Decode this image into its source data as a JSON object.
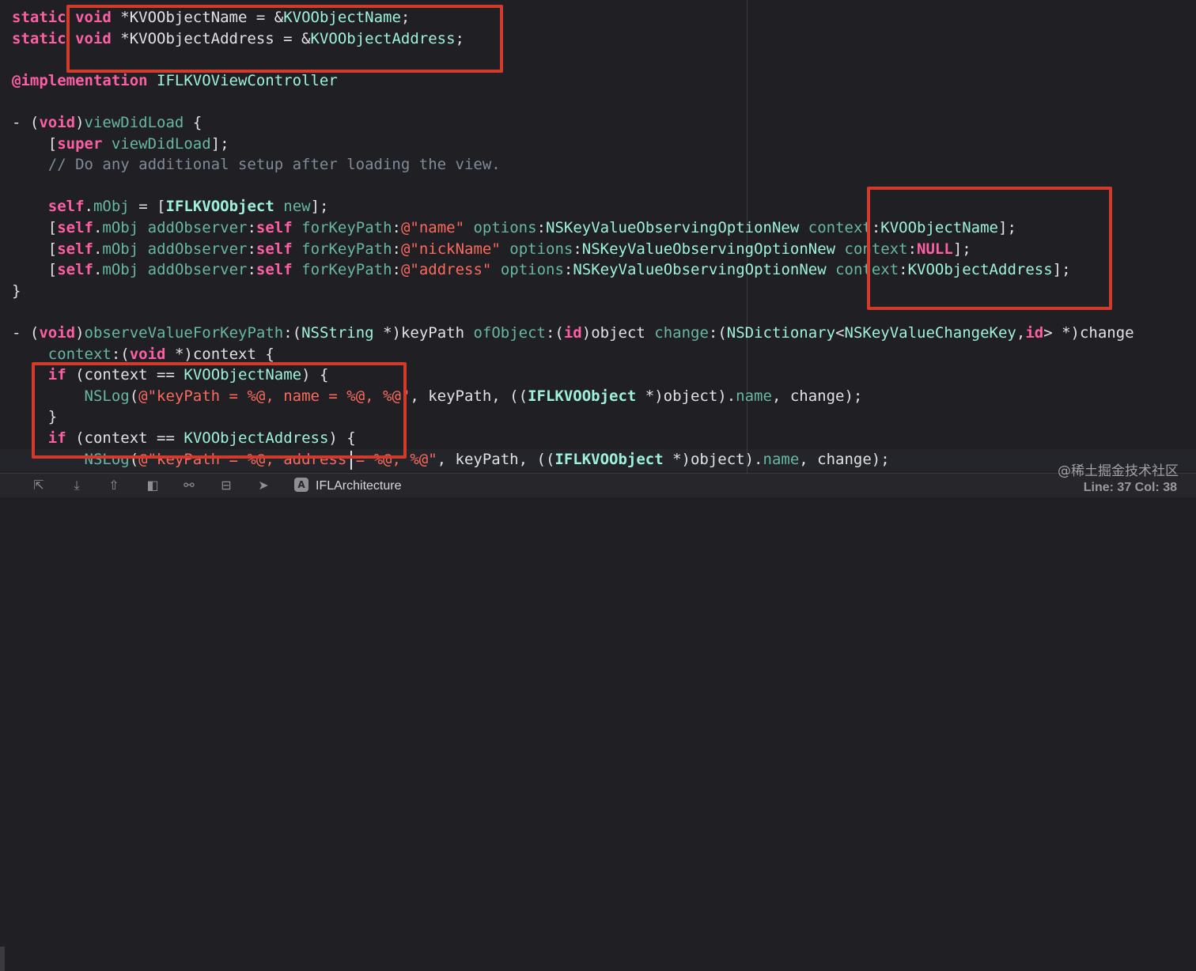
{
  "editor": {
    "lines": [
      [
        {
          "t": "static ",
          "c": "kw"
        },
        {
          "t": "void ",
          "c": "kw"
        },
        {
          "t": "*KVOObjectName = &",
          "c": "pl"
        },
        {
          "t": "KVOObjectName",
          "c": "ty"
        },
        {
          "t": ";",
          "c": "pl"
        }
      ],
      [
        {
          "t": "static ",
          "c": "kw"
        },
        {
          "t": "void ",
          "c": "kw"
        },
        {
          "t": "*KVOObjectAddress = &",
          "c": "pl"
        },
        {
          "t": "KVOObjectAddress",
          "c": "ty"
        },
        {
          "t": ";",
          "c": "pl"
        }
      ],
      [],
      [
        {
          "t": "@implementation ",
          "c": "kw"
        },
        {
          "t": "IFLKVOViewController",
          "c": "ty"
        }
      ],
      [],
      [
        {
          "t": "- (",
          "c": "pl"
        },
        {
          "t": "void",
          "c": "kw"
        },
        {
          "t": ")",
          "c": "pl"
        },
        {
          "t": "viewDidLoad",
          "c": "fn"
        },
        {
          "t": " {",
          "c": "pl"
        }
      ],
      [
        {
          "t": "    [",
          "c": "pl"
        },
        {
          "t": "super ",
          "c": "kw"
        },
        {
          "t": "viewDidLoad",
          "c": "fn"
        },
        {
          "t": "];",
          "c": "pl"
        }
      ],
      [
        {
          "t": "    // Do any additional setup after loading the view.",
          "c": "cm"
        }
      ],
      [],
      [
        {
          "t": "    ",
          "c": "pl"
        },
        {
          "t": "self",
          "c": "kw"
        },
        {
          "t": ".",
          "c": "pl"
        },
        {
          "t": "mObj",
          "c": "fn"
        },
        {
          "t": " = [",
          "c": "pl"
        },
        {
          "t": "IFLKVOObject",
          "c": "cls sel"
        },
        {
          "t": " ",
          "c": "pl"
        },
        {
          "t": "new",
          "c": "fn"
        },
        {
          "t": "];",
          "c": "pl"
        }
      ],
      [
        {
          "t": "    [",
          "c": "pl"
        },
        {
          "t": "self",
          "c": "kw"
        },
        {
          "t": ".",
          "c": "pl"
        },
        {
          "t": "mObj ",
          "c": "fn"
        },
        {
          "t": "addObserver",
          "c": "fn"
        },
        {
          "t": ":",
          "c": "pl"
        },
        {
          "t": "self ",
          "c": "kw"
        },
        {
          "t": "forKeyPath",
          "c": "fn"
        },
        {
          "t": ":",
          "c": "pl"
        },
        {
          "t": "@\"name\" ",
          "c": "str"
        },
        {
          "t": "options",
          "c": "fn"
        },
        {
          "t": ":",
          "c": "pl"
        },
        {
          "t": "NSKeyValueObservingOptionNew ",
          "c": "ty"
        },
        {
          "t": "context",
          "c": "fn"
        },
        {
          "t": ":",
          "c": "pl"
        },
        {
          "t": "KVOObjectName",
          "c": "ty"
        },
        {
          "t": "];",
          "c": "pl"
        }
      ],
      [
        {
          "t": "    [",
          "c": "pl"
        },
        {
          "t": "self",
          "c": "kw"
        },
        {
          "t": ".",
          "c": "pl"
        },
        {
          "t": "mObj ",
          "c": "fn"
        },
        {
          "t": "addObserver",
          "c": "fn"
        },
        {
          "t": ":",
          "c": "pl"
        },
        {
          "t": "self ",
          "c": "kw"
        },
        {
          "t": "forKeyPath",
          "c": "fn"
        },
        {
          "t": ":",
          "c": "pl"
        },
        {
          "t": "@\"nickName\" ",
          "c": "str"
        },
        {
          "t": "options",
          "c": "fn"
        },
        {
          "t": ":",
          "c": "pl"
        },
        {
          "t": "NSKeyValueObservingOptionNew ",
          "c": "ty"
        },
        {
          "t": "context",
          "c": "fn"
        },
        {
          "t": ":",
          "c": "pl"
        },
        {
          "t": "NULL",
          "c": "nul"
        },
        {
          "t": "];",
          "c": "pl"
        }
      ],
      [
        {
          "t": "    [",
          "c": "pl"
        },
        {
          "t": "self",
          "c": "kw"
        },
        {
          "t": ".",
          "c": "pl"
        },
        {
          "t": "mObj ",
          "c": "fn"
        },
        {
          "t": "addObserver",
          "c": "fn"
        },
        {
          "t": ":",
          "c": "pl"
        },
        {
          "t": "self ",
          "c": "kw"
        },
        {
          "t": "forKeyPath",
          "c": "fn"
        },
        {
          "t": ":",
          "c": "pl"
        },
        {
          "t": "@\"address\" ",
          "c": "str"
        },
        {
          "t": "options",
          "c": "fn"
        },
        {
          "t": ":",
          "c": "pl"
        },
        {
          "t": "NSKeyValueObservingOptionNew ",
          "c": "ty"
        },
        {
          "t": "context",
          "c": "fn"
        },
        {
          "t": ":",
          "c": "pl"
        },
        {
          "t": "KVOObjectAddress",
          "c": "ty"
        },
        {
          "t": "];",
          "c": "pl"
        }
      ],
      [
        {
          "t": "}",
          "c": "pl"
        }
      ],
      [],
      [
        {
          "t": "- (",
          "c": "pl"
        },
        {
          "t": "void",
          "c": "kw"
        },
        {
          "t": ")",
          "c": "pl"
        },
        {
          "t": "observeValueForKeyPath",
          "c": "fn"
        },
        {
          "t": ":(",
          "c": "pl"
        },
        {
          "t": "NSString ",
          "c": "ty"
        },
        {
          "t": "*)keyPath ",
          "c": "pl"
        },
        {
          "t": "ofObject",
          "c": "fn"
        },
        {
          "t": ":(",
          "c": "pl"
        },
        {
          "t": "id",
          "c": "kw"
        },
        {
          "t": ")object ",
          "c": "pl"
        },
        {
          "t": "change",
          "c": "fn"
        },
        {
          "t": ":(",
          "c": "pl"
        },
        {
          "t": "NSDictionary",
          "c": "ty"
        },
        {
          "t": "<",
          "c": "pl"
        },
        {
          "t": "NSKeyValueChangeKey",
          "c": "ty"
        },
        {
          "t": ",",
          "c": "pl"
        },
        {
          "t": "id",
          "c": "kw"
        },
        {
          "t": "> *)change",
          "c": "pl"
        }
      ],
      [
        {
          "t": "    ",
          "c": "pl"
        },
        {
          "t": "context",
          "c": "fn"
        },
        {
          "t": ":(",
          "c": "pl"
        },
        {
          "t": "void ",
          "c": "kw"
        },
        {
          "t": "*)context {",
          "c": "pl"
        }
      ],
      [
        {
          "t": "    ",
          "c": "pl"
        },
        {
          "t": "if ",
          "c": "kw"
        },
        {
          "t": "(context == ",
          "c": "pl"
        },
        {
          "t": "KVOObjectName",
          "c": "ty"
        },
        {
          "t": ") {",
          "c": "pl"
        }
      ],
      [
        {
          "t": "        ",
          "c": "pl"
        },
        {
          "t": "NSLog",
          "c": "fn"
        },
        {
          "t": "(",
          "c": "pl"
        },
        {
          "t": "@\"keyPath = %@, name = %@, %@\"",
          "c": "str"
        },
        {
          "t": ", keyPath, ((",
          "c": "pl"
        },
        {
          "t": "IFLKVOObject ",
          "c": "cls"
        },
        {
          "t": "*)object).",
          "c": "pl"
        },
        {
          "t": "name",
          "c": "fn"
        },
        {
          "t": ", change);",
          "c": "pl"
        }
      ],
      [
        {
          "t": "    }",
          "c": "pl"
        }
      ],
      [
        {
          "t": "    ",
          "c": "pl"
        },
        {
          "t": "if ",
          "c": "kw"
        },
        {
          "t": "(context == ",
          "c": "pl"
        },
        {
          "t": "KVOObjectAddress",
          "c": "ty"
        },
        {
          "t": ") {",
          "c": "pl"
        }
      ],
      [
        {
          "t": "        ",
          "c": "pl"
        },
        {
          "t": "NSLog",
          "c": "fn"
        },
        {
          "t": "(",
          "c": "pl"
        },
        {
          "t": "@\"keyPath = %@, address = %@, %@\"",
          "c": "str"
        },
        {
          "t": ", keyPath, ((",
          "c": "pl"
        },
        {
          "t": "IFLKVOObject ",
          "c": "cls"
        },
        {
          "t": "*)object).",
          "c": "pl"
        },
        {
          "t": "name",
          "c": "fn"
        },
        {
          "t": ", change);",
          "c": "pl"
        }
      ]
    ]
  },
  "statusbar": {
    "scheme_icon": "A",
    "project_name": "IFLArchitecture",
    "position": "Line: 37  Col: 38",
    "icons": [
      "breakpoint-continue-icon",
      "step-over-icon",
      "step-into-icon",
      "step-out-icon",
      "debug-view-hierarchy-icon",
      "memory-graph-icon",
      "environment-overrides-icon",
      "simulate-location-icon"
    ]
  },
  "watermark": "@稀土掘金技术社区",
  "colors": {
    "background": "#1f1f24",
    "annotation": "#d23a2c",
    "keyword": "#fc5fa3",
    "string": "#fc6a5d",
    "type": "#9ef1dd"
  }
}
